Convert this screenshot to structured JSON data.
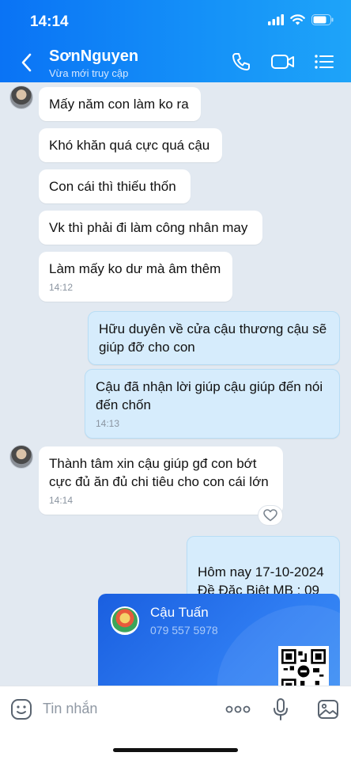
{
  "status_bar": {
    "time": "14:14"
  },
  "header": {
    "contact_name": "SơnNguyen",
    "contact_status": "Vừa mới truy cập"
  },
  "messages": [
    {
      "direction": "in",
      "text": "Mấy năm con làm ko ra"
    },
    {
      "direction": "in",
      "text": "Khó khăn quá cực quá cậu"
    },
    {
      "direction": "in",
      "text": "Con cái thì thiếu thốn"
    },
    {
      "direction": "in",
      "text": "Vk thì phải đi làm công nhân may"
    },
    {
      "direction": "in",
      "text": "Làm mấy ko dư mà âm thêm",
      "time": "14:12"
    },
    {
      "direction": "out",
      "text": "Hữu duyên về cửa cậu thương cậu sẽ giúp đỡ cho con"
    },
    {
      "direction": "out",
      "text": "Cậu đã nhận lời giúp cậu giúp đến nói đến chốn",
      "time": "14:13"
    },
    {
      "direction": "in",
      "text": "Thành tâm xin cậu giúp gđ con bớt cực đủ ăn đủ chi tiêu cho con cái lớn",
      "time": "14:14"
    },
    {
      "direction": "out",
      "text": "Hôm nay 17-10-2024\nĐề Đặc Biệt MB : 09"
    }
  ],
  "contact_card": {
    "name": "Cậu Tuấn",
    "phone": "079 557 5978"
  },
  "composer": {
    "placeholder": "Tin nhắn"
  },
  "colors": {
    "header_gradient_start": "#0a73f5",
    "header_gradient_end": "#1ea4f9",
    "chat_background": "#e2e9f1",
    "outgoing_bubble": "#d6ecfc",
    "incoming_bubble": "#ffffff",
    "card_blue": "#2f7df2"
  },
  "icons": [
    "back-icon",
    "phone-icon",
    "video-call-icon",
    "menu-list-icon",
    "sticker-icon",
    "more-dots-icon",
    "microphone-icon",
    "image-icon",
    "heart-icon"
  ]
}
